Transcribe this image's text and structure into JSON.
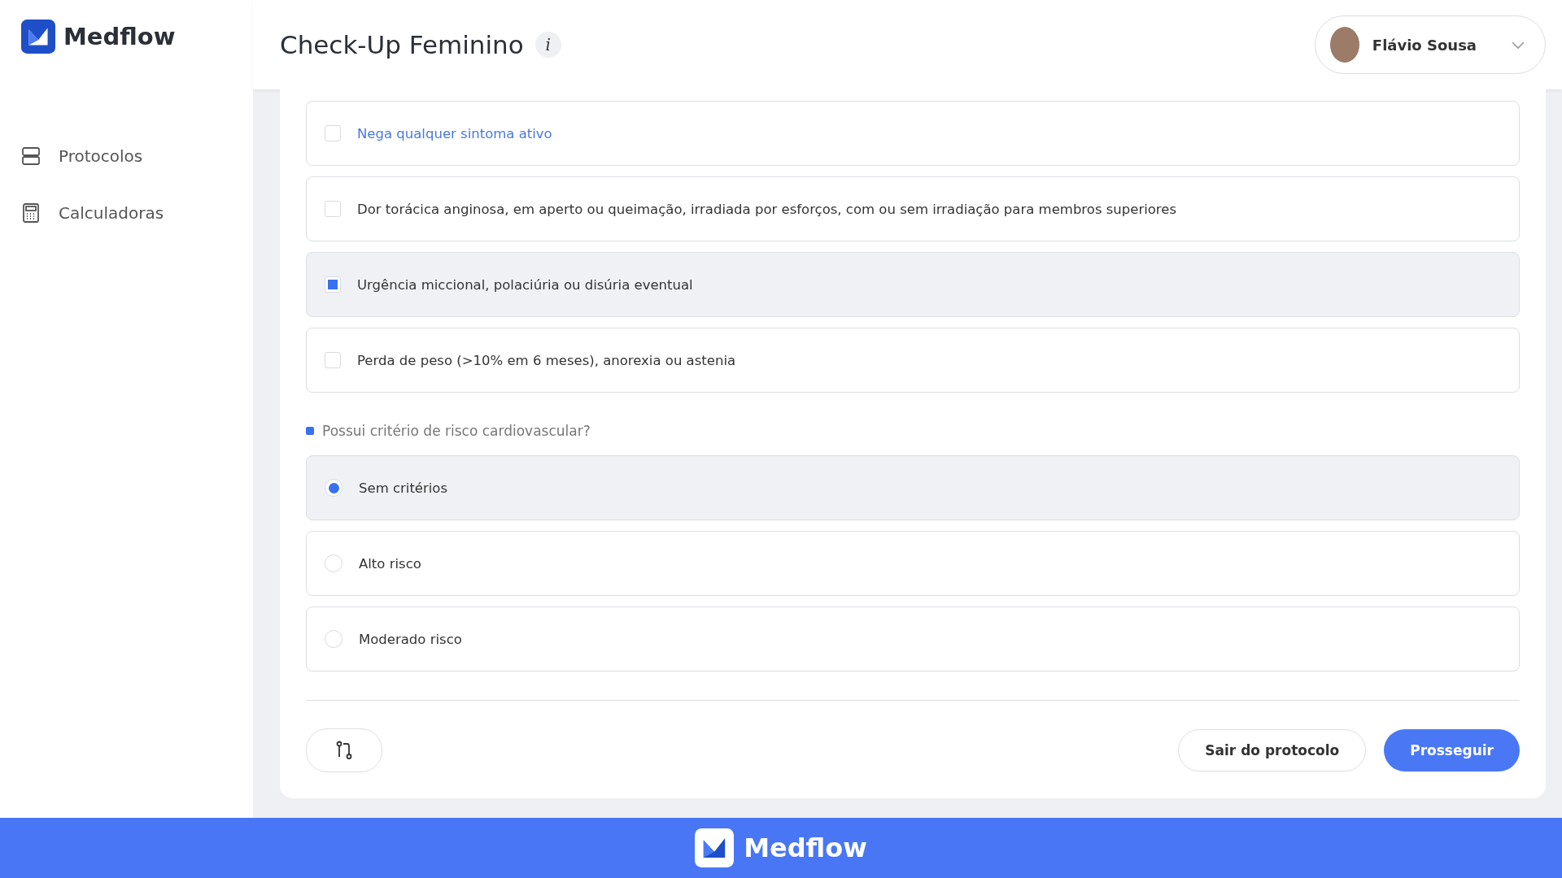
{
  "brand": {
    "name": "Medflow"
  },
  "sidebar": {
    "items": [
      {
        "label": "Protocolos"
      },
      {
        "label": "Calculadoras"
      }
    ]
  },
  "header": {
    "title": "Check-Up Feminino",
    "info": "i",
    "user": {
      "name": "Flávio Sousa"
    }
  },
  "symptoms": [
    {
      "label": "Nega qualquer sintoma ativo",
      "checked": false,
      "highlighted": true
    },
    {
      "label": "Dor torácica anginosa, em aperto ou queimação, irradiada por esforços, com ou sem irradiação para membros superiores",
      "checked": false,
      "highlighted": false
    },
    {
      "label": "Urgência miccional, polaciúria ou disúria eventual",
      "checked": true,
      "highlighted": false
    },
    {
      "label": "Perda de peso (>10% em 6 meses), anorexia ou astenia",
      "checked": false,
      "highlighted": false
    }
  ],
  "question": {
    "label": "Possui critério de risco cardiovascular?",
    "options": [
      {
        "label": "Sem critérios",
        "selected": true
      },
      {
        "label": "Alto risco",
        "selected": false
      },
      {
        "label": "Moderado risco",
        "selected": false
      }
    ]
  },
  "actions": {
    "exit": "Sair do protocolo",
    "next": "Prosseguir"
  },
  "footer": {
    "brand": "Medflow"
  }
}
